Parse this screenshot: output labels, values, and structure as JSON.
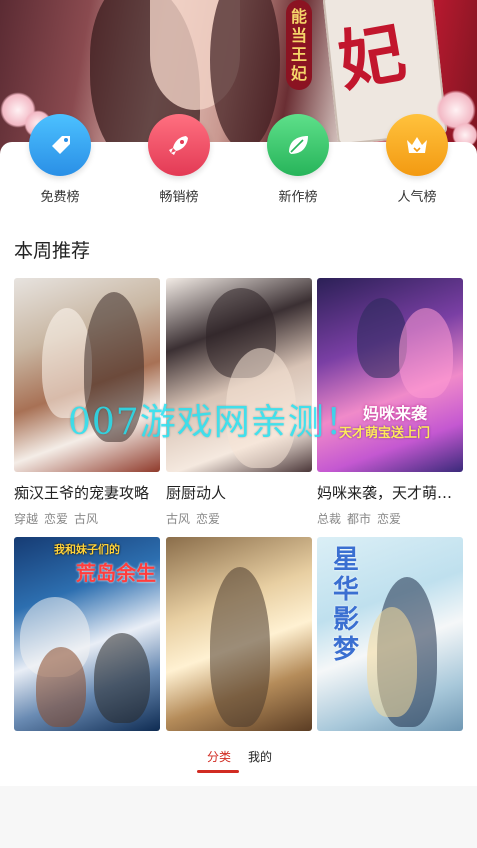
{
  "banner": {
    "vertical_title": [
      "能",
      "当",
      "王",
      "妃"
    ],
    "big_title": "妃"
  },
  "categories": [
    {
      "label": "免费榜",
      "icon": "tag-icon",
      "color": "#3fa9f5"
    },
    {
      "label": "畅销榜",
      "icon": "rocket-icon",
      "color": "#f0506a"
    },
    {
      "label": "新作榜",
      "icon": "leaf-icon",
      "color": "#3cc46a"
    },
    {
      "label": "人气榜",
      "icon": "crown-icon",
      "color": "#f7a51c"
    }
  ],
  "section": {
    "title": "本周推荐"
  },
  "books": [
    {
      "title": "痴汉王爷的宠妻攻略",
      "tags": [
        "穿越",
        "恋爱",
        "古风"
      ]
    },
    {
      "title": "厨厨动人",
      "tags": [
        "古风",
        "恋爱"
      ]
    },
    {
      "title": "妈咪来袭，天才萌宝送上门",
      "tags": [
        "总裁",
        "都市",
        "恋爱"
      ]
    },
    {
      "title": "",
      "tags": []
    },
    {
      "title": "",
      "tags": []
    },
    {
      "title": "",
      "tags": []
    }
  ],
  "covers": {
    "c3_line1": "妈咪来袭",
    "c3_line2": "天才萌宝送上门",
    "c4_line1": "我和妹子们的",
    "c4_line2": "荒岛余生",
    "c6_title": "星华影梦"
  },
  "watermark": "007游戏网亲测！",
  "tabbar": {
    "tabs": [
      {
        "label": "分类",
        "active": true
      },
      {
        "label": "我的",
        "active": false
      }
    ]
  }
}
